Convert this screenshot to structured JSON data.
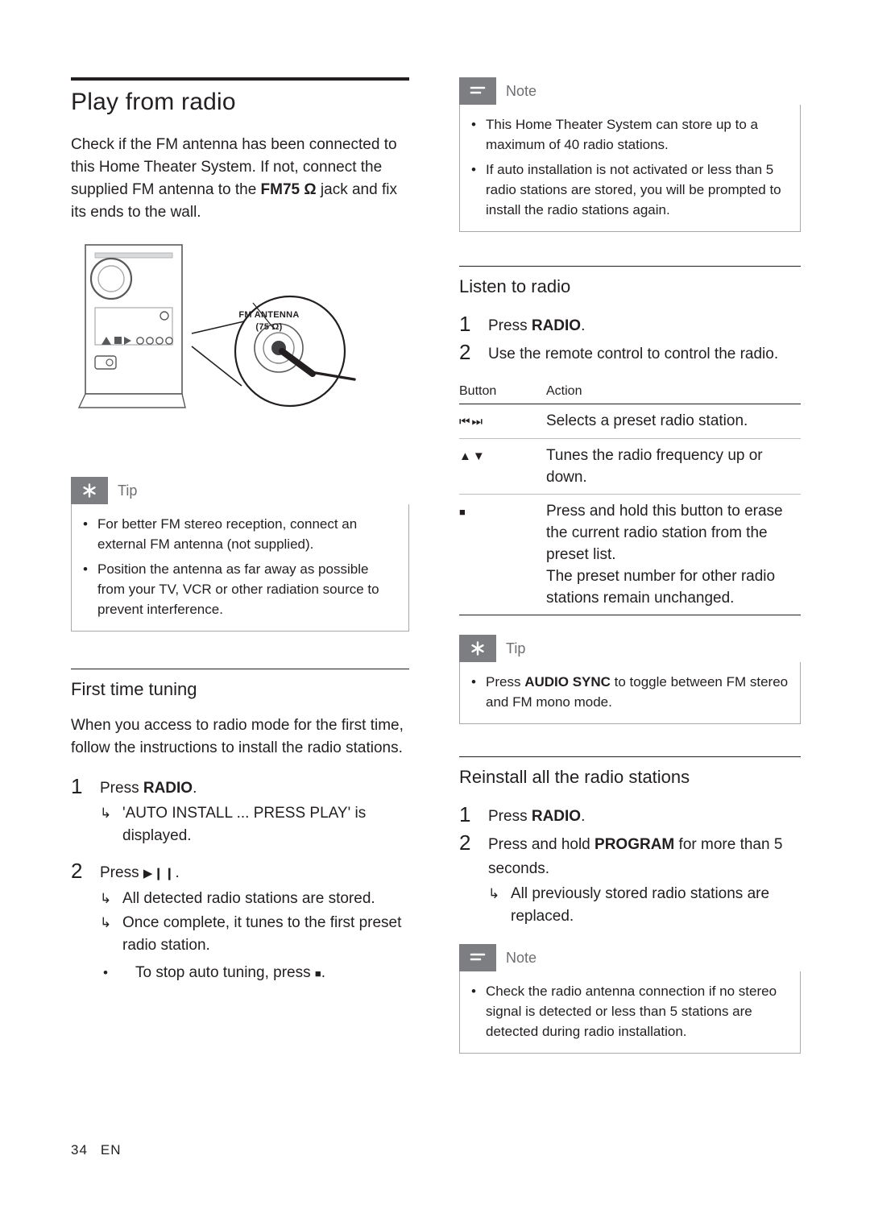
{
  "page": {
    "number": "34",
    "lang": "EN"
  },
  "left": {
    "title": "Play from radio",
    "intro_part1": "Check if the FM antenna has been connected to this Home Theater System. If not, connect the supplied FM antenna to the ",
    "intro_bold": "FM75 Ω",
    "intro_part2": " jack and fix its ends to the wall.",
    "illustration": {
      "label_line1": "FM ANTENNA",
      "label_line2": "(75 Ω)"
    },
    "tip": {
      "label": "Tip",
      "items": [
        "For better FM stereo reception, connect an external FM antenna (not supplied).",
        "Position the antenna as far away as possible from your TV, VCR or other radiation source to prevent interference."
      ]
    },
    "first_time": {
      "heading": "First time tuning",
      "intro": "When you access to radio mode for the first time, follow the instructions to install the radio stations.",
      "step1_num": "1",
      "step1_text_a": "Press ",
      "step1_text_b": "RADIO",
      "step1_text_c": ".",
      "step1_sub": "'AUTO INSTALL ... PRESS PLAY' is displayed.",
      "step2_num": "2",
      "step2_text_a": "Press ",
      "step2_text_c": ".",
      "step2_sub1": "All detected radio stations are stored.",
      "step2_sub2": "Once complete, it tunes to the first preset radio station.",
      "step2_bullet": "To stop auto tuning, press"
    }
  },
  "right": {
    "note_top": {
      "label": "Note",
      "items": [
        "This Home Theater System can store up to a maximum of 40 radio stations.",
        "If auto installation is not activated or less than 5 radio stations are stored, you will be prompted to install the radio stations again."
      ]
    },
    "listen": {
      "heading": "Listen to radio",
      "step1_num": "1",
      "step1_text_a": "Press ",
      "step1_text_b": "RADIO",
      "step1_text_c": ".",
      "step2_num": "2",
      "step2_text": "Use the remote control to control the radio."
    },
    "table": {
      "header": [
        "Button",
        "Action"
      ],
      "rows": [
        {
          "button_icon": "prev-next-track-icon",
          "action": "Selects a preset radio station."
        },
        {
          "button_icon": "up-down-arrows-icon",
          "action": "Tunes the radio frequency up or down."
        },
        {
          "button_icon": "stop-square-icon",
          "action": "Press and hold this button to erase the current radio station from the preset list.\nThe preset number for other radio stations remain unchanged."
        }
      ]
    },
    "tip": {
      "label": "Tip",
      "item_a": "Press ",
      "item_b": "AUDIO SYNC",
      "item_c": " to toggle between FM stereo and FM mono mode."
    },
    "reinstall": {
      "heading": "Reinstall all the radio stations",
      "step1_num": "1",
      "step1_text_a": "Press ",
      "step1_text_b": "RADIO",
      "step1_text_c": ".",
      "step2_num": "2",
      "step2_text_a": "Press and hold ",
      "step2_text_b": "PROGRAM",
      "step2_text_c": " for more than 5 seconds.",
      "step2_sub": "All previously stored radio stations are replaced."
    },
    "note_bottom": {
      "label": "Note",
      "items": [
        "Check the radio antenna connection if no stereo signal is detected or less than 5 stations are detected during radio installation."
      ]
    }
  }
}
